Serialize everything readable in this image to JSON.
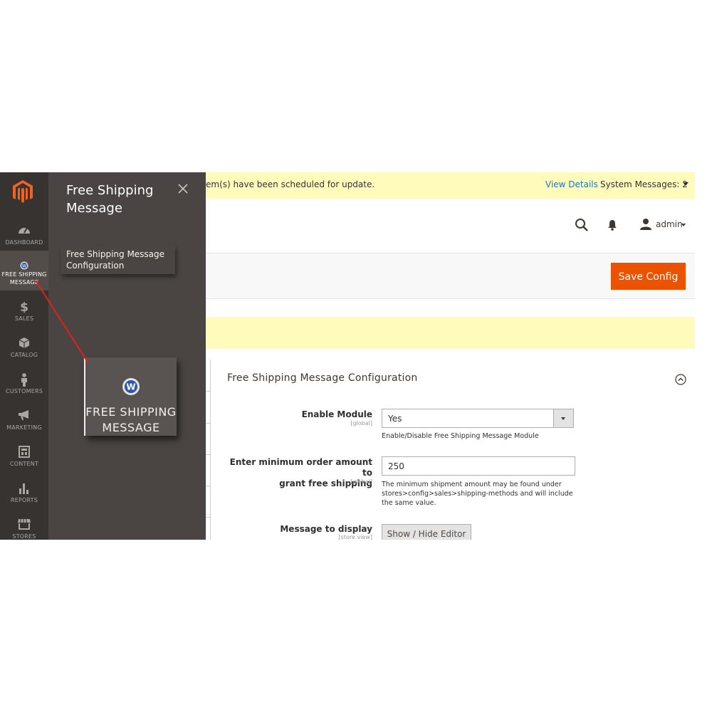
{
  "nav": {
    "items": [
      {
        "label": "DASHBOARD",
        "icon": "dashboard-icon"
      },
      {
        "label": "FREE SHIPPING MESSAGE",
        "label_line1": "FREE SHIPPING",
        "label_line2": "MESSAGE",
        "icon": "extension-logo-icon",
        "active": true
      },
      {
        "label": "SALES",
        "icon": "dollar-icon"
      },
      {
        "label": "CATALOG",
        "icon": "box-icon"
      },
      {
        "label": "CUSTOMERS",
        "icon": "person-icon"
      },
      {
        "label": "MARKETING",
        "icon": "megaphone-icon"
      },
      {
        "label": "CONTENT",
        "icon": "layout-icon"
      },
      {
        "label": "REPORTS",
        "icon": "bar-chart-icon"
      },
      {
        "label": "STORES",
        "icon": "store-icon"
      }
    ]
  },
  "panel": {
    "title": "Free Shipping Message",
    "link": "Free Shipping Message Configuration",
    "zoom_label_line1": "FREE SHIPPING",
    "zoom_label_line2": "MESSAGE"
  },
  "system_message": {
    "text": "em(s) have been scheduled for update.",
    "link": "View Details",
    "count_label": "System Messages: 2"
  },
  "header": {
    "user": "admin"
  },
  "actions": {
    "save_label": "Save Config"
  },
  "section": {
    "title": "Free Shipping Message Configuration",
    "fields": {
      "enable": {
        "label": "Enable Module",
        "scope": "[global]",
        "value": "Yes",
        "note": "Enable/Disable Free Shipping Message Module"
      },
      "min_amount": {
        "label_line1": "Enter minimum order amount to",
        "label_line2": "grant free shipping",
        "scope": "[global]",
        "value": "250",
        "note": "The minimum shipment amount may be found under stores>config>sales>shipping-methods and will include the same value."
      },
      "message": {
        "label": "Message to display",
        "scope": "[store view]",
        "button": "Show / Hide Editor"
      }
    }
  },
  "colors": {
    "nav_bg": "#373330",
    "panel_bg": "#4a4542",
    "accent": "#eb5202",
    "message_bg": "#fffbbb",
    "link": "#1979c3",
    "pointer_line": "#e02020"
  }
}
